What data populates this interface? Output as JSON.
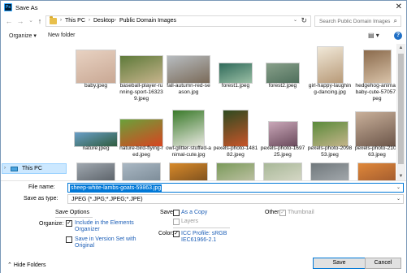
{
  "window": {
    "title": "Save As",
    "app_logo_text": "Ps",
    "close_glyph": "✕"
  },
  "nav": {
    "back_glyph": "←",
    "forward_glyph": "→",
    "recent_glyph": "⌄",
    "up_glyph": "↑",
    "breadcrumbs": [
      "This PC",
      "Desktop",
      "Public Domain Images"
    ],
    "search_placeholder": "Search Public Domain Images"
  },
  "toolbar": {
    "organize_label": "Organize ▾",
    "new_folder_label": "New folder",
    "view_glyph": "▤ ▾",
    "help_glyph": "?"
  },
  "sidebar": {
    "selected_label": "This PC",
    "expand_glyph": "›"
  },
  "files": [
    {
      "name": "baby.jpeg",
      "colors": [
        "#e8d2c2",
        "#c9a894"
      ]
    },
    {
      "name": "baseball-player-running-sport-163239.jpeg",
      "colors": [
        "#5e7a3a",
        "#c7b48c"
      ]
    },
    {
      "name": "fall-autumn-red-season.jpg",
      "colors": [
        "#b7bcc0",
        "#7a6a58"
      ]
    },
    {
      "name": "forest1.jpeg",
      "colors": [
        "#2f6a5a",
        "#9bbfa5"
      ]
    },
    {
      "name": "forest2.jpeg",
      "colors": [
        "#88a08a",
        "#4f6f5c"
      ]
    },
    {
      "name": "girl-happy-laughing-dancing.jpg",
      "colors": [
        "#f0e8d8",
        "#b89a78"
      ]
    },
    {
      "name": "hedgehog-animal-baby-cute-57057.jpeg",
      "colors": [
        "#8a6a4c",
        "#d9c3a9"
      ]
    },
    {
      "name": "nature.jpeg",
      "colors": [
        "#6a9fc8",
        "#2f5c3e"
      ]
    },
    {
      "name": "nature-bird-flying-red.jpeg",
      "colors": [
        "#6aa13a",
        "#d84420"
      ]
    },
    {
      "name": "owl-glitter-stuffed-animal-cute.jpg",
      "colors": [
        "#3a7a2a",
        "#e8e8e0"
      ]
    },
    {
      "name": "pexels-photo-148182.jpeg",
      "colors": [
        "#2e4a20",
        "#c8552a"
      ]
    },
    {
      "name": "pexels-photo-169725.jpeg",
      "colors": [
        "#c9a7b8",
        "#6a4a5c"
      ]
    },
    {
      "name": "pexels-photo-209853.jpeg",
      "colors": [
        "#5a8a3a",
        "#c4b48a"
      ]
    },
    {
      "name": "pexels-photo-210563.jpeg",
      "colors": [
        "#c9b09a",
        "#6a5448"
      ]
    },
    {
      "name": "",
      "colors": [
        "#a0a8b0",
        "#40464c"
      ]
    },
    {
      "name": "",
      "colors": [
        "#aab8c4",
        "#6a7a86"
      ]
    },
    {
      "name": "",
      "colors": [
        "#d88a2a",
        "#5a3a1a"
      ]
    },
    {
      "name": "",
      "colors": [
        "#7a9a5a",
        "#d8d0c0"
      ]
    },
    {
      "name": "",
      "colors": [
        "#a8b898",
        "#e8e4d8"
      ]
    },
    {
      "name": "",
      "colors": [
        "#70787c",
        "#b8bcc0"
      ]
    },
    {
      "name": "",
      "colors": [
        "#e0883a",
        "#8a4a2a"
      ]
    }
  ],
  "form": {
    "file_name_label": "File name:",
    "file_name_value": "sheep-white-lambs-goats-59863.jpg",
    "save_as_type_label": "Save as type:",
    "save_as_type_value": "JPEG (*.JPG;*.JPEG;*.JPE)",
    "save_options_label": "Save Options",
    "organize_label": "Organize:",
    "include_organizer": "Include in the Elements Organizer",
    "save_version_set": "Save in Version Set with Original",
    "save_label": "Save:",
    "as_copy": "As a Copy",
    "layers": "Layers",
    "other_label": "Other:",
    "thumbnail": "Thumbnail",
    "color_label": "Color:",
    "icc_profile": "ICC Profile:  sRGB IEC61966-2.1",
    "check_glyph": "✓"
  },
  "footer": {
    "hide_folders": "Hide Folders",
    "save_button": "Save",
    "cancel_button": "Cancel"
  }
}
